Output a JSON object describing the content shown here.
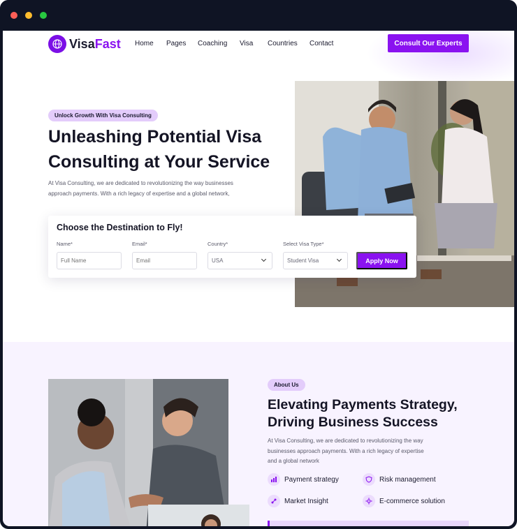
{
  "brand": {
    "name_part1": "Visa",
    "name_part2": "Fast",
    "accent": "#8a12f0"
  },
  "nav": {
    "items": [
      "Home",
      "Pages",
      "Coaching",
      "Visa",
      "Countries",
      "Contact"
    ],
    "cta_label": "Consult Our Experts"
  },
  "hero": {
    "badge": "Unlock Growth With Visa Consulting",
    "title_line1": "Unleashing Potential Visa",
    "title_line2": "Consulting at Your Service",
    "desc_line1": "At Visa Consulting, we are dedicated to revolutionizing the way businesses",
    "desc_line2": "approach payments. With a rich legacy of expertise and a global network,"
  },
  "form": {
    "title": "Choose the Destination to Fly!",
    "fields": [
      {
        "label": "Name*",
        "placeholder": "Full Name"
      },
      {
        "label": "Email*",
        "placeholder": "Email"
      },
      {
        "label": "Country*",
        "value": "USA"
      },
      {
        "label": "Select Visa Type*",
        "value": "Student Visa"
      }
    ],
    "submit_label": "Apply Now"
  },
  "about": {
    "badge": "About Us",
    "title_line1": "Elevating Payments Strategy,",
    "title_line2": "Driving Business Success",
    "desc_line1": "At Visa Consulting, we are dedicated to revolutionizing the way",
    "desc_line2": "businesses approach payments. With a rich legacy of expertise",
    "desc_line3": "and a global network",
    "features": [
      "Payment strategy",
      "Risk management",
      "Market Insight",
      "E-commerce solution"
    ]
  },
  "colors": {
    "window_chrome": "#0f1424",
    "dot_red": "#ff5f57",
    "dot_yellow": "#febc2e",
    "dot_green": "#28c840"
  }
}
